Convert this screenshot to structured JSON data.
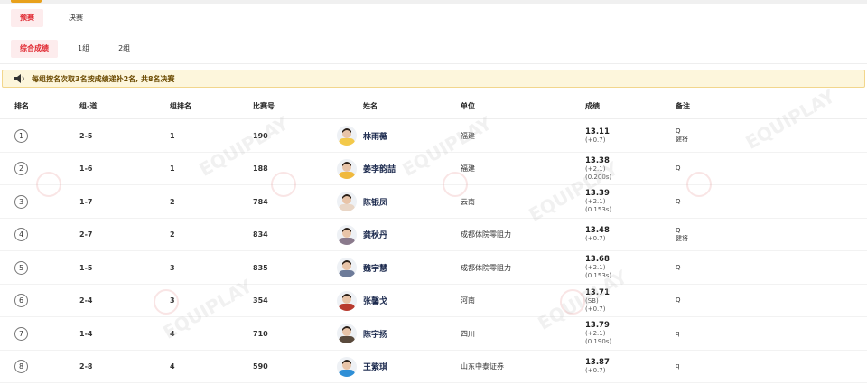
{
  "stage_tabs": [
    {
      "label": "预赛",
      "active": true
    },
    {
      "label": "决赛",
      "active": false
    }
  ],
  "group_tabs": [
    {
      "label": "综合成绩",
      "active": true
    },
    {
      "label": "1组",
      "active": false
    },
    {
      "label": "2组",
      "active": false
    }
  ],
  "notice": {
    "icon": "speaker-icon",
    "text": "每组按名次取3名按成绩递补2名, 共8名决赛"
  },
  "watermark": "EQUIPLAY",
  "columns": {
    "rank": "排名",
    "group_lane": "组-道",
    "group_rank": "组排名",
    "bib": "比赛号",
    "name": "姓名",
    "unit": "单位",
    "result": "成绩",
    "remark": "备注"
  },
  "rows": [
    {
      "rank": "1",
      "group_lane": "2-5",
      "group_rank": "1",
      "bib": "190",
      "name": "林雨薇",
      "unit": "福建",
      "perf": "13.11",
      "subs": [
        "(+0.7)"
      ],
      "q": "Q",
      "note": "健将",
      "avatar_color": "#f3c94a"
    },
    {
      "rank": "2",
      "group_lane": "1-6",
      "group_rank": "1",
      "bib": "188",
      "name": "姜李韵喆",
      "unit": "福建",
      "perf": "13.38",
      "subs": [
        "(+2.1)",
        "(0.200s)"
      ],
      "q": "Q",
      "note": "",
      "avatar_color": "#f0b93d"
    },
    {
      "rank": "3",
      "group_lane": "1-7",
      "group_rank": "2",
      "bib": "784",
      "name": "陈银凤",
      "unit": "云南",
      "perf": "13.39",
      "subs": [
        "(+2.1)",
        "(0.153s)"
      ],
      "q": "Q",
      "note": "",
      "avatar_color": "#e9d6c6"
    },
    {
      "rank": "4",
      "group_lane": "2-7",
      "group_rank": "2",
      "bib": "834",
      "name": "龚秋丹",
      "unit": "成都体院零阻力",
      "perf": "13.48",
      "subs": [
        "(+0.7)"
      ],
      "q": "Q",
      "note": "健将",
      "avatar_color": "#8a7a8c"
    },
    {
      "rank": "5",
      "group_lane": "1-5",
      "group_rank": "3",
      "bib": "835",
      "name": "魏宇慧",
      "unit": "成都体院零阻力",
      "perf": "13.68",
      "subs": [
        "(+2.1)",
        "(0.153s)"
      ],
      "q": "Q",
      "note": "",
      "avatar_color": "#6d7b99"
    },
    {
      "rank": "6",
      "group_lane": "2-4",
      "group_rank": "3",
      "bib": "354",
      "name": "张馨戈",
      "unit": "河南",
      "perf": "13.71",
      "subs": [
        "(SB)",
        "(+0.7)"
      ],
      "q": "Q",
      "note": "",
      "avatar_color": "#b83a2e"
    },
    {
      "rank": "7",
      "group_lane": "1-4",
      "group_rank": "4",
      "bib": "710",
      "name": "陈宇扬",
      "unit": "四川",
      "perf": "13.79",
      "subs": [
        "(+2.1)",
        "(0.190s)"
      ],
      "q": "q",
      "note": "",
      "avatar_color": "#5a4a3c"
    },
    {
      "rank": "8",
      "group_lane": "2-8",
      "group_rank": "4",
      "bib": "590",
      "name": "王紫琪",
      "unit": "山东中泰证券",
      "perf": "13.87",
      "subs": [
        "(+0.7)"
      ],
      "q": "q",
      "note": "",
      "avatar_color": "#2f8fd6"
    }
  ],
  "colors": {
    "accent": "#e0262f",
    "tab_bg": "#fdeced",
    "notice_bg": "#fdf6dc",
    "notice_border": "#f2d68c",
    "indicator": "#e8a11c"
  }
}
